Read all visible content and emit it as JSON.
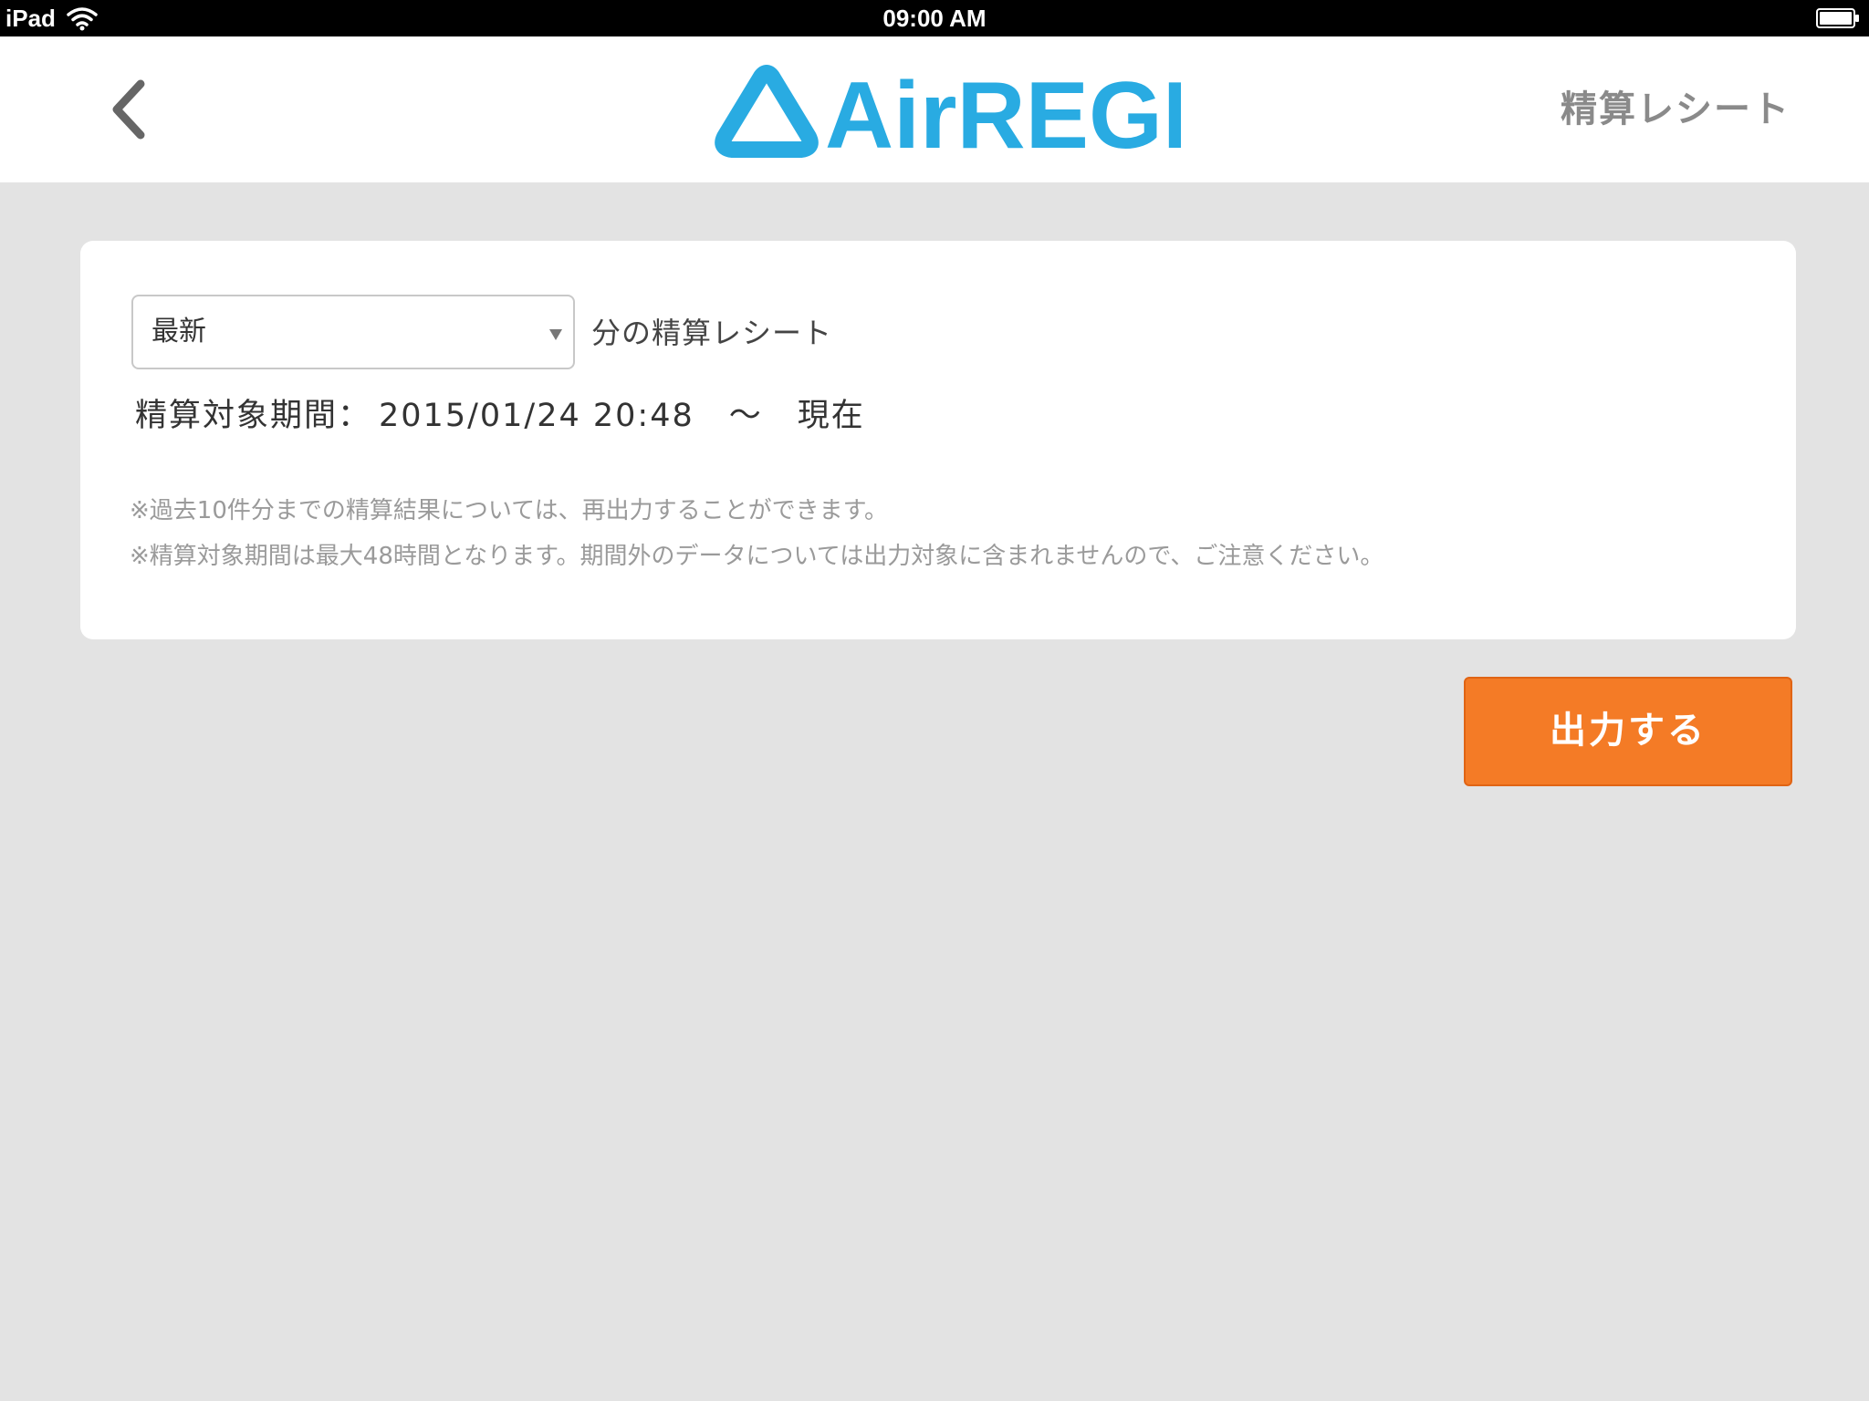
{
  "status_bar": {
    "device": "iPad",
    "time": "09:00 AM",
    "wifi_icon": "wifi-icon",
    "battery_icon": "battery-icon"
  },
  "nav": {
    "back_icon": "chevron-left-icon",
    "logo_text": "AirREGI",
    "title": "精算レシート"
  },
  "form": {
    "period_select": {
      "selected": "最新"
    },
    "select_suffix": "分の精算レシート",
    "period": {
      "label": "精算対象期間：",
      "start": "2015/01/24 20:48",
      "separator": "〜",
      "end": "現在"
    },
    "notes": [
      "※過去10件分までの精算結果については、再出力することができます。",
      "※精算対象期間は最大48時間となります。期間外のデータについては出力対象に含まれませんので、ご注意ください。"
    ]
  },
  "actions": {
    "output_label": "出力する"
  },
  "colors": {
    "brand_blue": "#29abe2",
    "accent_orange": "#f47b26",
    "background": "#e3e3e3"
  }
}
